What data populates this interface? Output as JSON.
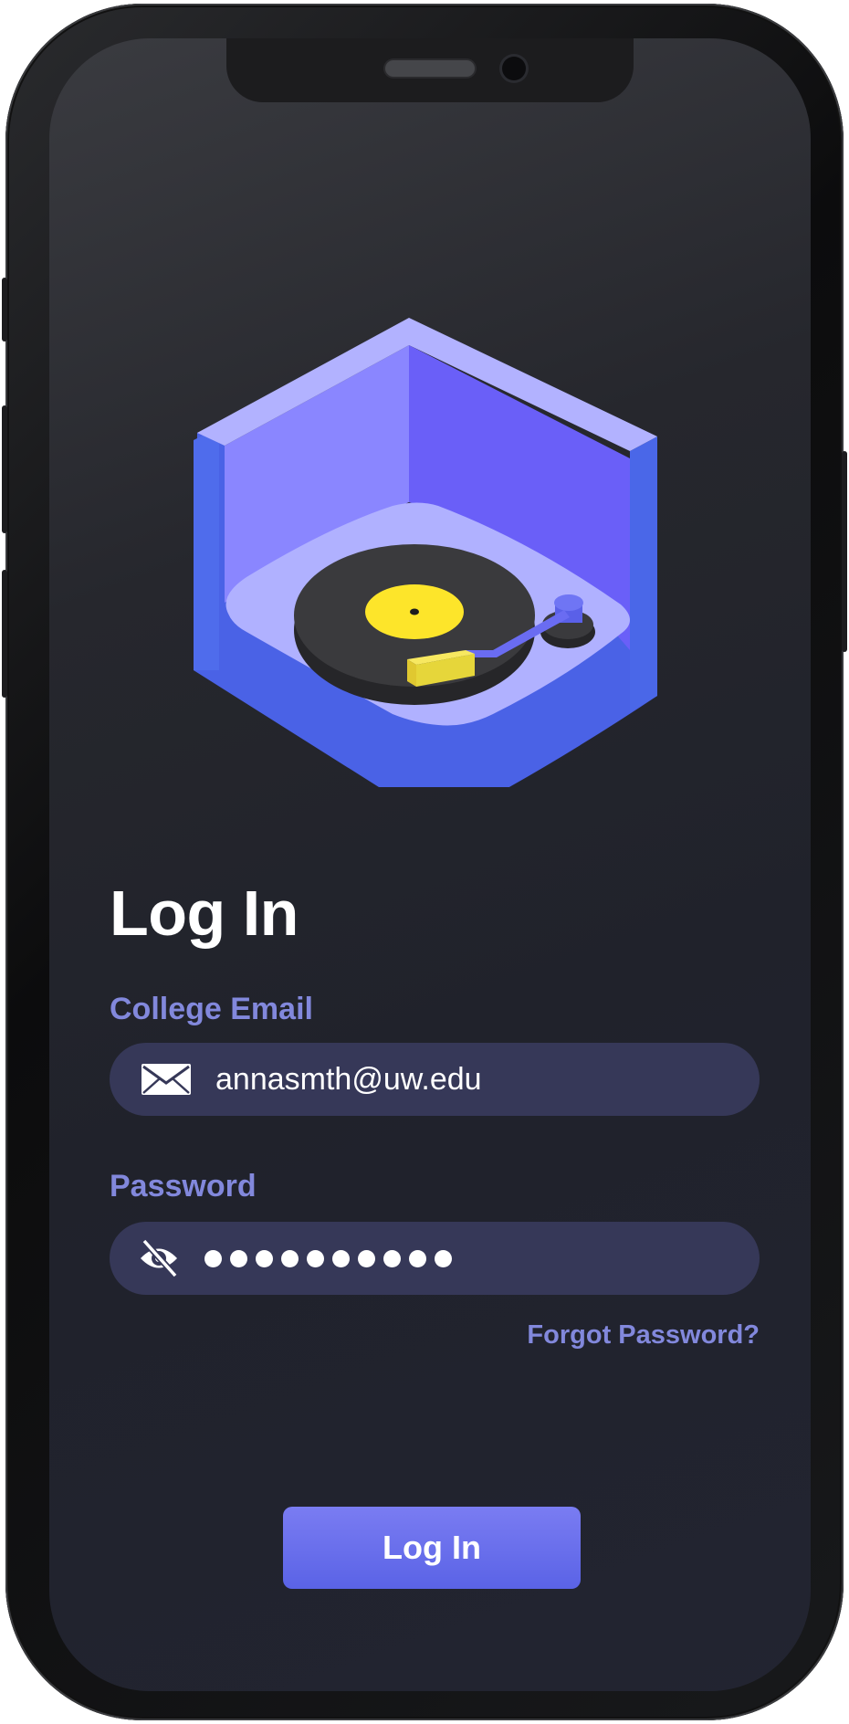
{
  "page": {
    "title": "Log In"
  },
  "email": {
    "label": "College Email",
    "value": "annasmth@uw.edu",
    "icon": "envelope-icon"
  },
  "password": {
    "label": "Password",
    "masked_length": 10,
    "icon": "eye-slash-icon"
  },
  "forgot_link": "Forgot Password?",
  "login_button": "Log In",
  "illustration": {
    "icon": "turntable-illustration"
  },
  "colors": {
    "accent": "#8288dc",
    "field_bg": "#363858",
    "button": "#6b70ee",
    "record_label": "#fde52a",
    "box_light": "#b0b1ff",
    "box_dark": "#4a67e8"
  }
}
